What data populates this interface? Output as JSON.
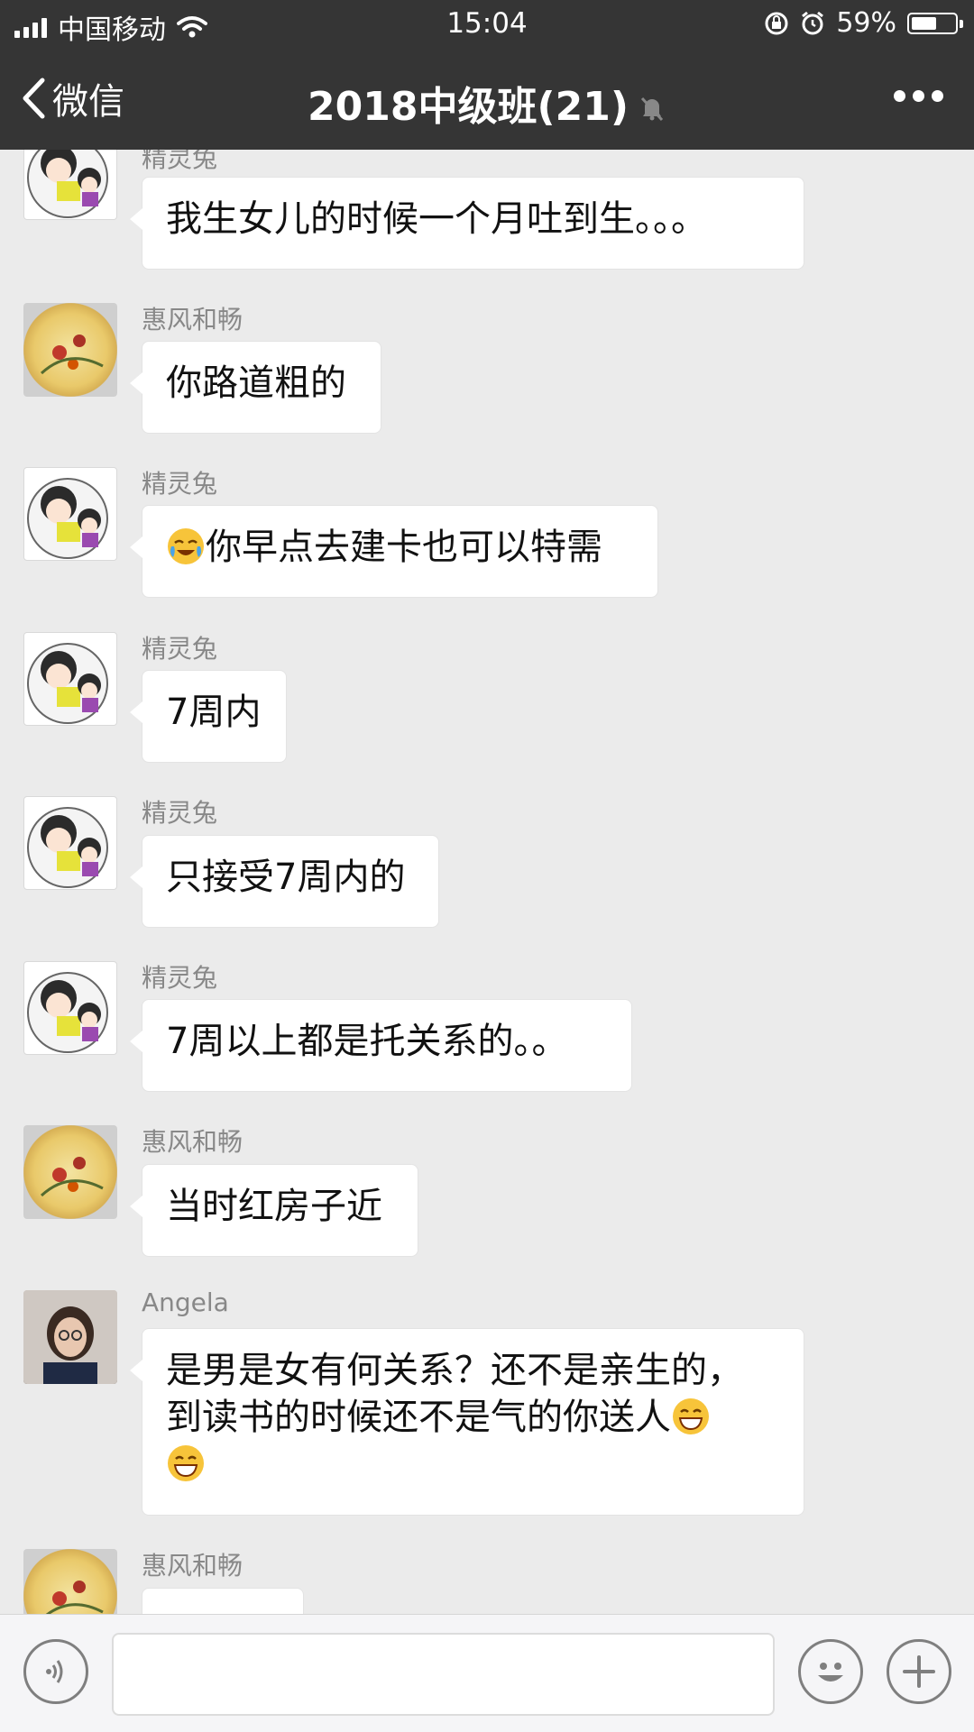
{
  "status_bar": {
    "carrier": "中国移动",
    "time": "15:04",
    "battery_text": "59%",
    "battery_level": 0.59
  },
  "nav": {
    "back_label": "微信",
    "title": "2018中级班(21)"
  },
  "messages": [
    {
      "sender": "精灵兔",
      "avatar": "girl-avatar",
      "text": "我生女儿的时候一个月吐到生。。。"
    },
    {
      "sender": "惠风和畅",
      "avatar": "flower-avatar",
      "text": "你路道粗的"
    },
    {
      "sender": "精灵兔",
      "avatar": "girl-avatar",
      "emoji": "crying-laughing-emoji",
      "text": "你早点去建卡也可以特需"
    },
    {
      "sender": "精灵兔",
      "avatar": "girl-avatar",
      "text": "7周内"
    },
    {
      "sender": "精灵兔",
      "avatar": "girl-avatar",
      "text": "只接受7周内的"
    },
    {
      "sender": "精灵兔",
      "avatar": "girl-avatar",
      "text": "7周以上都是托关系的。。"
    },
    {
      "sender": "惠风和畅",
      "avatar": "flower-avatar",
      "text": "当时红房子近"
    },
    {
      "sender": "Angela",
      "avatar": "photo-avatar",
      "text_line1": "是男是女有何关系？还不是亲生的，",
      "text_line2": "到读书的时候还不是气的你送人",
      "emoji": "grinning-emoji"
    },
    {
      "sender": "惠风和畅",
      "avatar": "flower-avatar",
      "text": ""
    }
  ],
  "input": {
    "value": "",
    "voice_icon": "voice-icon",
    "emoji_icon": "emoji-icon",
    "plus_icon": "plus-icon"
  }
}
